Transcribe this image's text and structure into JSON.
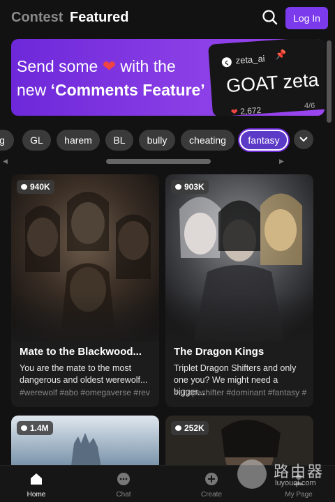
{
  "header": {
    "tab_contest": "Contest",
    "tab_featured": "Featured",
    "login_label": "Log In",
    "search_icon": "search-icon"
  },
  "banner": {
    "line1_pre": "Send some",
    "line1_post": "with the",
    "line2_pre": "new",
    "line2_bold": "‘Comments Feature’",
    "promo_user": "zeta_ai",
    "promo_title": "GOAT zeta",
    "promo_likes": "2,672",
    "page_indicator": "4/6"
  },
  "chips": {
    "items": [
      "g",
      "GL",
      "harem",
      "BL",
      "bully",
      "cheating",
      "fantasy"
    ],
    "selected": "fantasy"
  },
  "cards": [
    {
      "count": "940K",
      "title": "Mate to the Blackwood...",
      "desc": "You are the mate to the most dangerous and oldest werewolf...",
      "tags": "#werewolf #abo #omegaverse #rev"
    },
    {
      "count": "903K",
      "title": "The Dragon Kings",
      "desc": "Triplet Dragon Shifters and only one you? We might need a bigger...",
      "tags": "#shapeshifter #dominant #fantasy #"
    },
    {
      "count": "1.4M"
    },
    {
      "count": "252K"
    }
  ],
  "nav": {
    "home": "Home",
    "chat": "Chat",
    "create": "Create",
    "mypage": "My Page",
    "active": "Home"
  },
  "watermark": {
    "big": "路由器",
    "small": "luyouqi.com"
  },
  "colors": {
    "accent": "#7c3aed",
    "background": "#121212"
  }
}
